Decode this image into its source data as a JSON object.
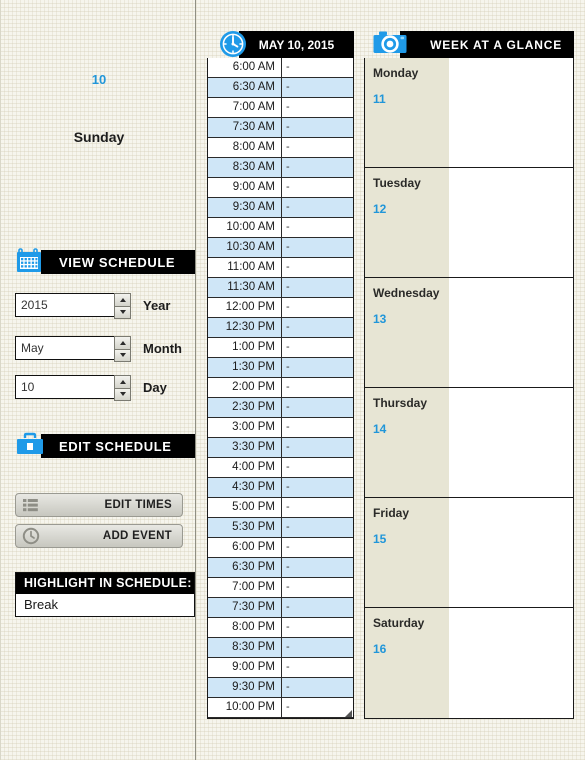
{
  "theme": {
    "accent_blue": "#2196d9",
    "row_highlight": "#cfe6f7",
    "day_column_bg": "#e7e5d4",
    "page_bg": "#f6f5ed",
    "header_bar_bg": "#000000"
  },
  "hero": {
    "date_number": "10",
    "day_name": "Sunday"
  },
  "view_schedule": {
    "title": "VIEW SCHEDULE",
    "icon": "calendar-icon",
    "fields": [
      {
        "value": "2015",
        "label": "Year",
        "name": "year"
      },
      {
        "value": "May",
        "label": "Month",
        "name": "month"
      },
      {
        "value": "10",
        "label": "Day",
        "name": "day"
      }
    ]
  },
  "edit_schedule": {
    "title": "EDIT SCHEDULE",
    "icon": "toolbox-icon",
    "buttons": [
      {
        "label": "EDIT TIMES",
        "icon": "list-icon"
      },
      {
        "label": "ADD EVENT",
        "icon": "clock-icon"
      }
    ]
  },
  "highlight": {
    "title": "HIGHLIGHT IN SCHEDULE:",
    "value": "Break"
  },
  "day_schedule": {
    "title": "MAY 10, 2015",
    "icon": "clock-icon",
    "empty_marker": "-",
    "rows": [
      {
        "time": "6:00 AM",
        "event": "-"
      },
      {
        "time": "6:30 AM",
        "event": "-"
      },
      {
        "time": "7:00 AM",
        "event": "-"
      },
      {
        "time": "7:30 AM",
        "event": "-"
      },
      {
        "time": "8:00 AM",
        "event": "-"
      },
      {
        "time": "8:30 AM",
        "event": "-"
      },
      {
        "time": "9:00 AM",
        "event": "-"
      },
      {
        "time": "9:30 AM",
        "event": "-"
      },
      {
        "time": "10:00 AM",
        "event": "-"
      },
      {
        "time": "10:30 AM",
        "event": "-"
      },
      {
        "time": "11:00 AM",
        "event": "-"
      },
      {
        "time": "11:30 AM",
        "event": "-"
      },
      {
        "time": "12:00 PM",
        "event": "-"
      },
      {
        "time": "12:30 PM",
        "event": "-"
      },
      {
        "time": "1:00 PM",
        "event": "-"
      },
      {
        "time": "1:30 PM",
        "event": "-"
      },
      {
        "time": "2:00 PM",
        "event": "-"
      },
      {
        "time": "2:30 PM",
        "event": "-"
      },
      {
        "time": "3:00 PM",
        "event": "-"
      },
      {
        "time": "3:30 PM",
        "event": "-"
      },
      {
        "time": "4:00 PM",
        "event": "-"
      },
      {
        "time": "4:30 PM",
        "event": "-"
      },
      {
        "time": "5:00 PM",
        "event": "-"
      },
      {
        "time": "5:30 PM",
        "event": "-"
      },
      {
        "time": "6:00 PM",
        "event": "-"
      },
      {
        "time": "6:30 PM",
        "event": "-"
      },
      {
        "time": "7:00 PM",
        "event": "-"
      },
      {
        "time": "7:30 PM",
        "event": "-"
      },
      {
        "time": "8:00 PM",
        "event": "-"
      },
      {
        "time": "8:30 PM",
        "event": "-"
      },
      {
        "time": "9:00 PM",
        "event": "-"
      },
      {
        "time": "9:30 PM",
        "event": "-"
      },
      {
        "time": "10:00 PM",
        "event": "-"
      }
    ]
  },
  "week": {
    "title": "WEEK AT A GLANCE",
    "icon": "camera-icon",
    "days": [
      {
        "name": "Monday",
        "number": "11",
        "events": ""
      },
      {
        "name": "Tuesday",
        "number": "12",
        "events": ""
      },
      {
        "name": "Wednesday",
        "number": "13",
        "events": ""
      },
      {
        "name": "Thursday",
        "number": "14",
        "events": ""
      },
      {
        "name": "Friday",
        "number": "15",
        "events": ""
      },
      {
        "name": "Saturday",
        "number": "16",
        "events": ""
      }
    ]
  }
}
